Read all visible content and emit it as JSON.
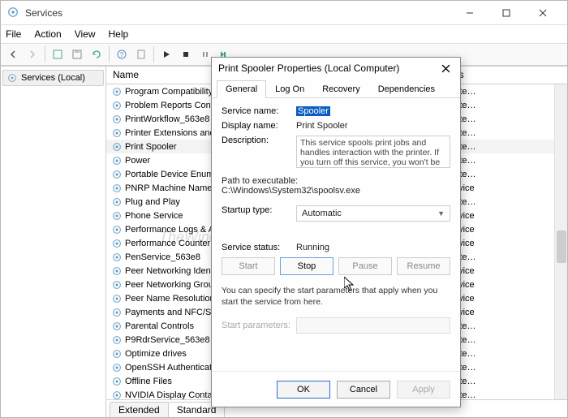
{
  "window": {
    "title": "Services",
    "menu": [
      "File",
      "Action",
      "View",
      "Help"
    ]
  },
  "leftPane": {
    "item": "Services (Local)"
  },
  "columns": {
    "name": "Name",
    "logon": "On As"
  },
  "services": [
    {
      "name": "Program Compatibility A",
      "logon": "Syste…"
    },
    {
      "name": "Problem Reports Contro",
      "logon": "Syste…"
    },
    {
      "name": "PrintWorkflow_563e8",
      "logon": "Syste…"
    },
    {
      "name": "Printer Extensions and N",
      "logon": "Syste…"
    },
    {
      "name": "Print Spooler",
      "logon": "Syste…",
      "selected": true
    },
    {
      "name": "Power",
      "logon": "Syste…"
    },
    {
      "name": "Portable Device Enumer",
      "logon": "Syste…"
    },
    {
      "name": "PNRP Machine Name Pu",
      "logon": "Service"
    },
    {
      "name": "Plug and Play",
      "logon": "Syste…"
    },
    {
      "name": "Phone Service",
      "logon": "Service"
    },
    {
      "name": "Performance Logs & Ale",
      "logon": "Service"
    },
    {
      "name": "Performance Counter Dl",
      "logon": "Service"
    },
    {
      "name": "PenService_563e8",
      "logon": "Syste…"
    },
    {
      "name": "Peer Networking Identity",
      "logon": "Service"
    },
    {
      "name": "Peer Networking Groupi",
      "logon": "Service"
    },
    {
      "name": "Peer Name Resolution Pr",
      "logon": "Service"
    },
    {
      "name": "Payments and NFC/SE M",
      "logon": "Service"
    },
    {
      "name": "Parental Controls",
      "logon": "Syste…"
    },
    {
      "name": "P9RdrService_563e8",
      "logon": "Syste…"
    },
    {
      "name": "Optimize drives",
      "logon": "Syste…"
    },
    {
      "name": "OpenSSH Authentication",
      "logon": "Syste…"
    },
    {
      "name": "Offline Files",
      "logon": "Syste…"
    },
    {
      "name": "NVIDIA Display Containe",
      "logon": "Syste…"
    }
  ],
  "footerTabs": {
    "extended": "Extended",
    "standard": "Standard"
  },
  "dialog": {
    "title": "Print Spooler Properties (Local Computer)",
    "tabs": [
      "General",
      "Log On",
      "Recovery",
      "Dependencies"
    ],
    "serviceNameLabel": "Service name:",
    "serviceNameValue": "Spooler",
    "displayNameLabel": "Display name:",
    "displayNameValue": "Print Spooler",
    "descriptionLabel": "Description:",
    "descriptionValue": "This service spools print jobs and handles interaction with the printer.  If you turn off this service, you won't be able to print or see your printers",
    "pathLabel": "Path to executable:",
    "pathValue": "C:\\Windows\\System32\\spoolsv.exe",
    "startupTypeLabel": "Startup type:",
    "startupTypeValue": "Automatic",
    "serviceStatusLabel": "Service status:",
    "serviceStatusValue": "Running",
    "buttons": {
      "start": "Start",
      "stop": "Stop",
      "pause": "Pause",
      "resume": "Resume"
    },
    "note": "You can specify the start parameters that apply when you start the service from here.",
    "startParamsLabel": "Start parameters:",
    "footer": {
      "ok": "OK",
      "cancel": "Cancel",
      "apply": "Apply"
    }
  },
  "watermark": "TheWindowsClub"
}
